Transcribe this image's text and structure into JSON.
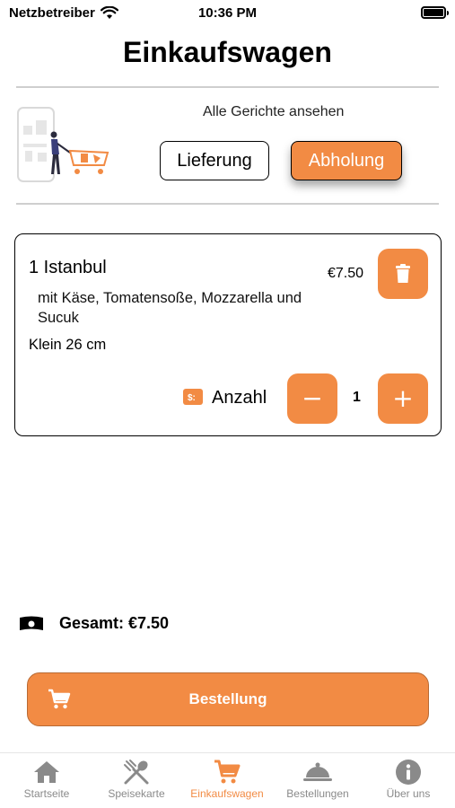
{
  "status_bar": {
    "carrier": "Netzbetreiber",
    "time": "10:36 PM"
  },
  "page": {
    "title": "Einkaufswagen"
  },
  "mode": {
    "see_all": "Alle Gerichte ansehen",
    "delivery_label": "Lieferung",
    "pickup_label": "Abholung",
    "selected": "Abholung"
  },
  "cart_item": {
    "title": "1 Istanbul",
    "description": "mit Käse, Tomatensoße, Mozzarella und Sucuk",
    "size": "Klein 26 cm",
    "price": "€7.50",
    "quantity_label": "Anzahl",
    "quantity": "1",
    "minus_symbol": "−",
    "plus_symbol": "+"
  },
  "total": {
    "label": "Gesamt: €7.50"
  },
  "order_button": {
    "label": "Bestellung"
  },
  "tabs": [
    {
      "label": "Startseite",
      "icon": "home-icon"
    },
    {
      "label": "Speisekarte",
      "icon": "cutlery-icon"
    },
    {
      "label": "Einkaufswagen",
      "icon": "cart-icon"
    },
    {
      "label": "Bestellungen",
      "icon": "cloche-icon"
    },
    {
      "label": "Über uns",
      "icon": "info-icon"
    }
  ],
  "active_tab": "Einkaufswagen",
  "colors": {
    "accent": "#f28b44",
    "tab_inactive": "#8a8a8a"
  }
}
